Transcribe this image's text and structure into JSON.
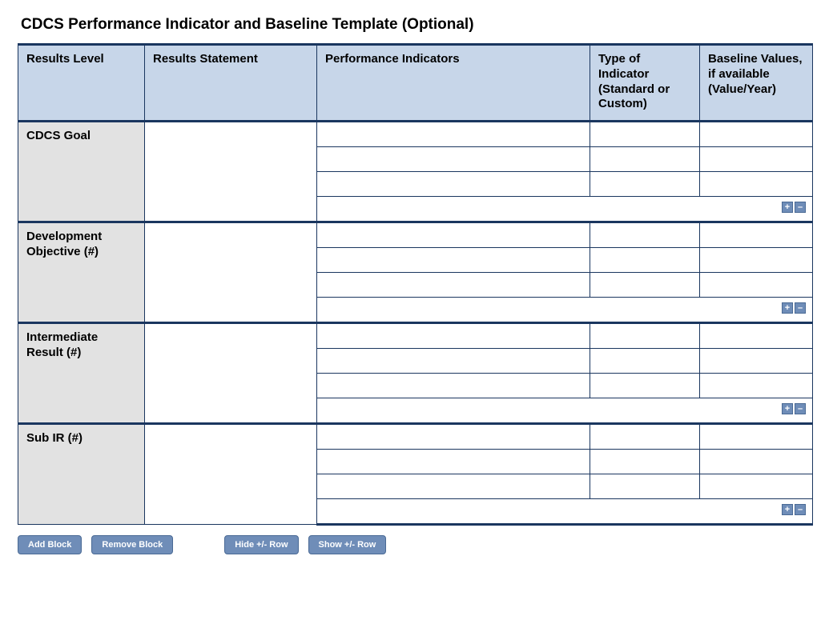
{
  "title": "CDCS Performance Indicator and Baseline Template (Optional)",
  "columns": {
    "results_level": "Results Level",
    "results_statement": "Results Statement",
    "performance_indicators": "Performance Indicators",
    "type_of_indicator": "Type of Indicator (Standard or Custom)",
    "baseline_values": "Baseline Values, if available (Value/Year)"
  },
  "blocks": [
    {
      "level_label": "CDCS Goal",
      "statement": "",
      "indicator_rows": 3
    },
    {
      "level_label": "Development Objective (#)",
      "statement": "",
      "indicator_rows": 3
    },
    {
      "level_label": "Intermediate Result (#)",
      "statement": "",
      "indicator_rows": 3
    },
    {
      "level_label": "Sub IR (#)",
      "statement": "",
      "indicator_rows": 3
    }
  ],
  "row_controls": {
    "plus": "+",
    "minus": "–"
  },
  "buttons": {
    "add_block": "Add Block",
    "remove_block": "Remove Block",
    "hide_pm_row": "Hide +/- Row",
    "show_pm_row": "Show +/- Row"
  }
}
